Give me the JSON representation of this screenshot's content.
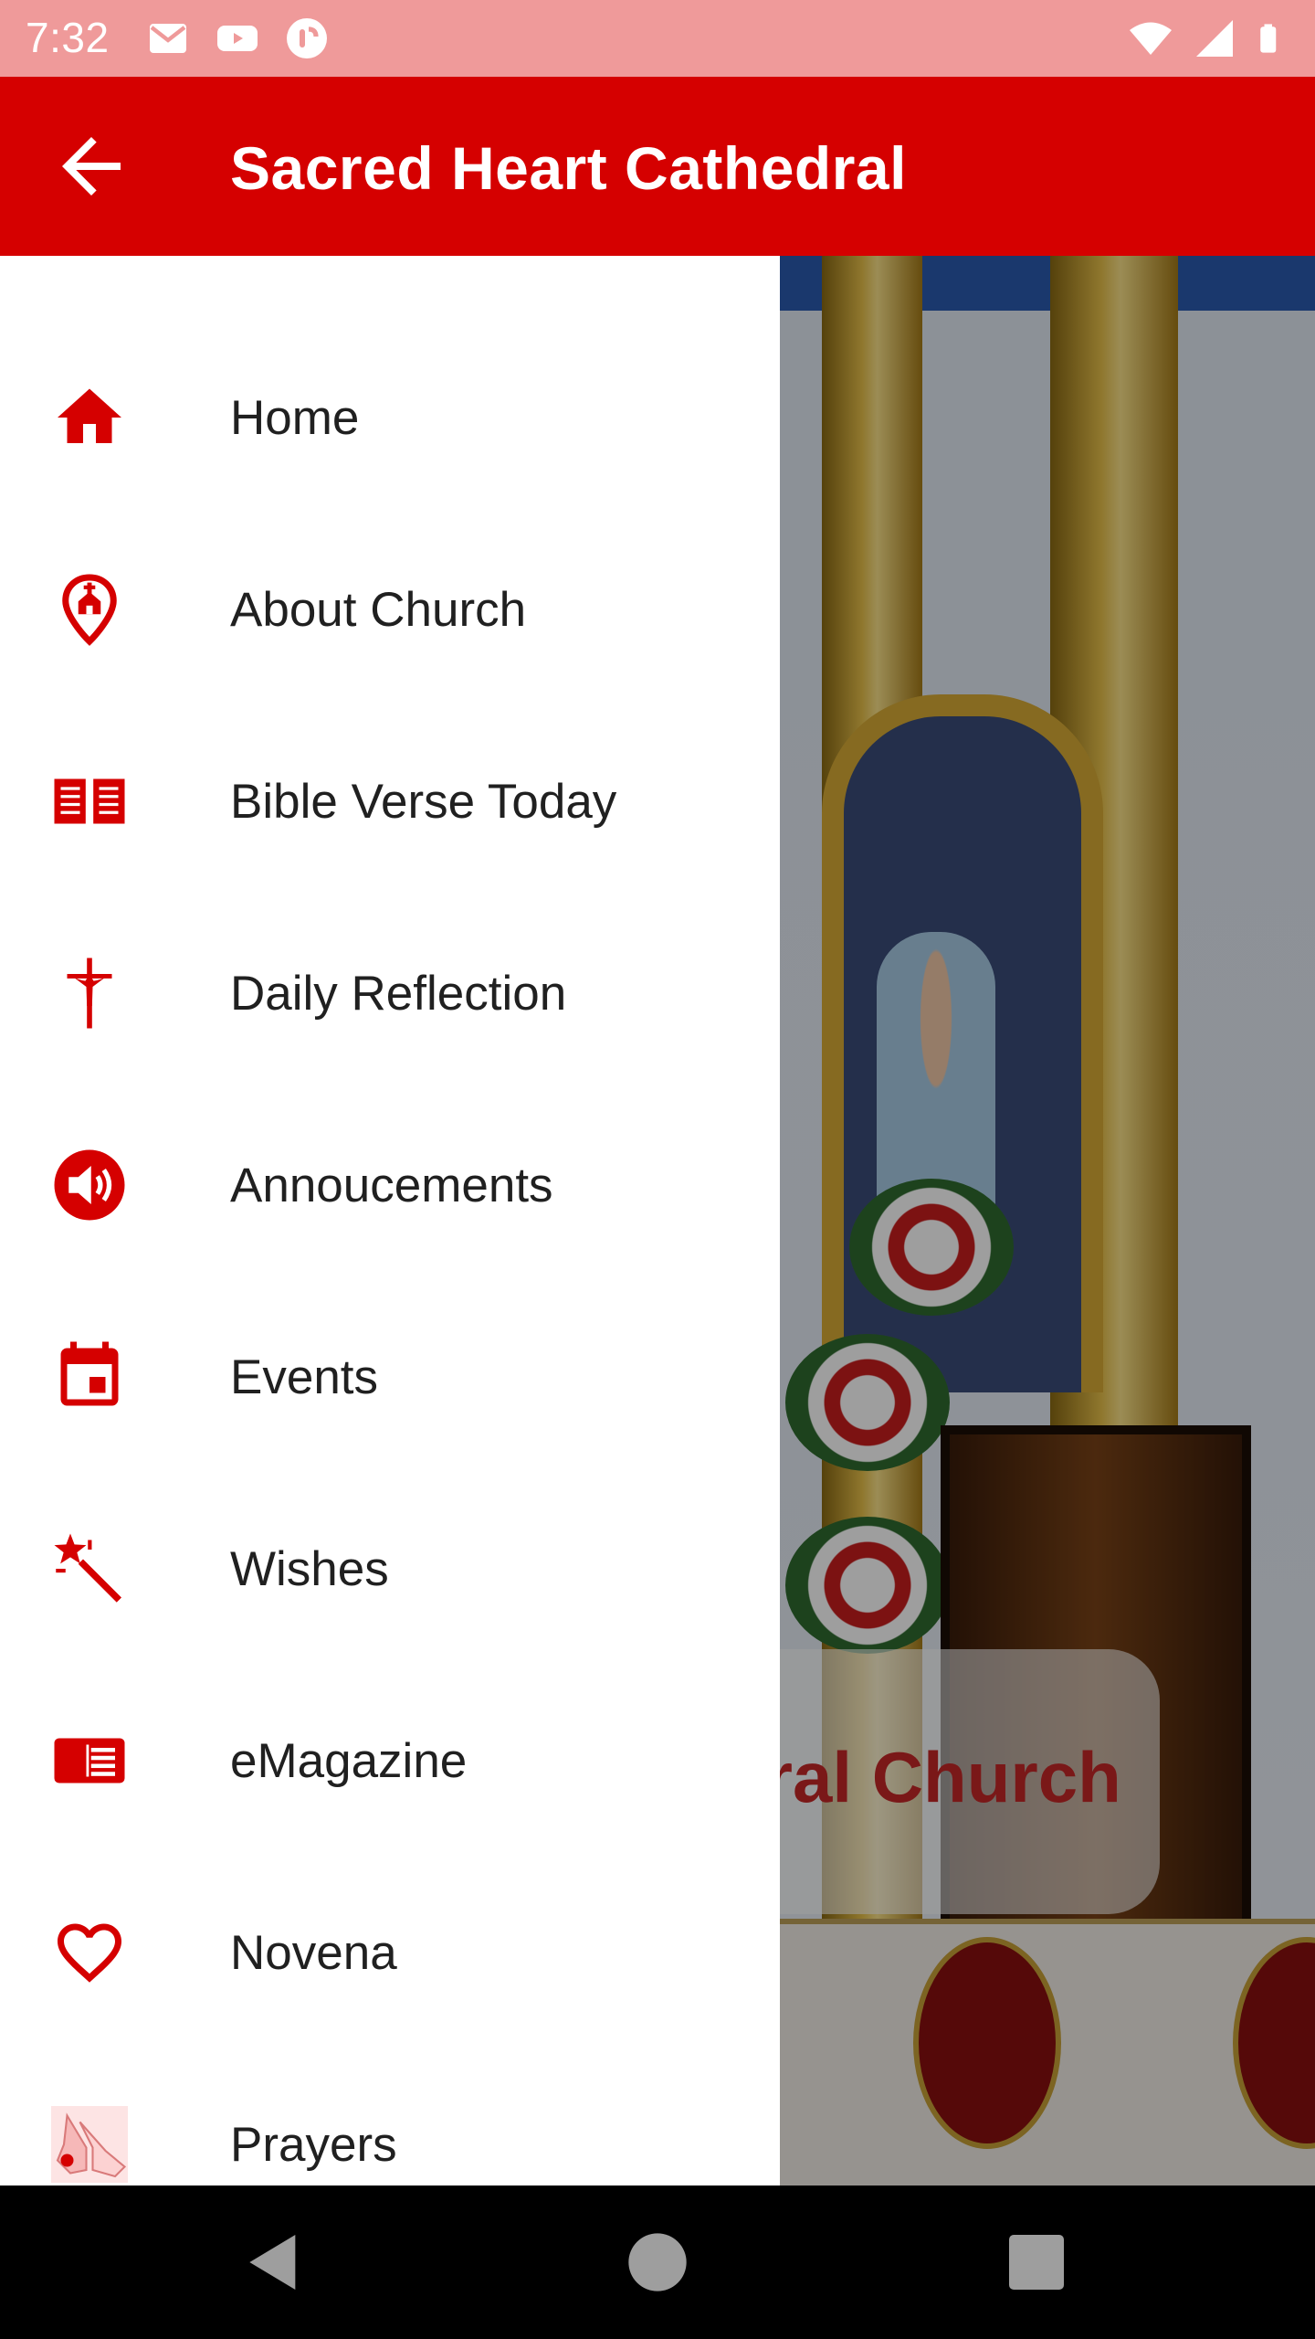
{
  "status_bar": {
    "time": "7:32",
    "left_icons": [
      "gmail-icon",
      "youtube-icon",
      "app-notification-icon"
    ],
    "right_icons": [
      "wifi-icon",
      "cell-signal-icon",
      "battery-icon"
    ]
  },
  "app_bar": {
    "title": "Sacred Heart Cathedral",
    "back_icon": "arrow-left-icon",
    "color": "#d50000"
  },
  "drawer": {
    "accent_color": "#d50000",
    "items": [
      {
        "label": "Home",
        "icon": "home-icon"
      },
      {
        "label": "About Church",
        "icon": "church-location-icon"
      },
      {
        "label": "Bible Verse Today",
        "icon": "open-book-icon"
      },
      {
        "label": "Daily Reflection",
        "icon": "crucifix-icon"
      },
      {
        "label": "Annoucements",
        "icon": "speaker-icon"
      },
      {
        "label": "Events",
        "icon": "calendar-icon"
      },
      {
        "label": "Wishes",
        "icon": "magic-wand-icon"
      },
      {
        "label": "eMagazine",
        "icon": "newspaper-icon"
      },
      {
        "label": "Novena",
        "icon": "heart-outline-icon"
      },
      {
        "label": "Prayers",
        "icon": "praying-hands-icon"
      }
    ]
  },
  "background": {
    "banner_text": "dral Church"
  },
  "nav_bar": {
    "buttons": [
      "back-triangle-icon",
      "home-circle-icon",
      "recents-square-icon"
    ]
  }
}
